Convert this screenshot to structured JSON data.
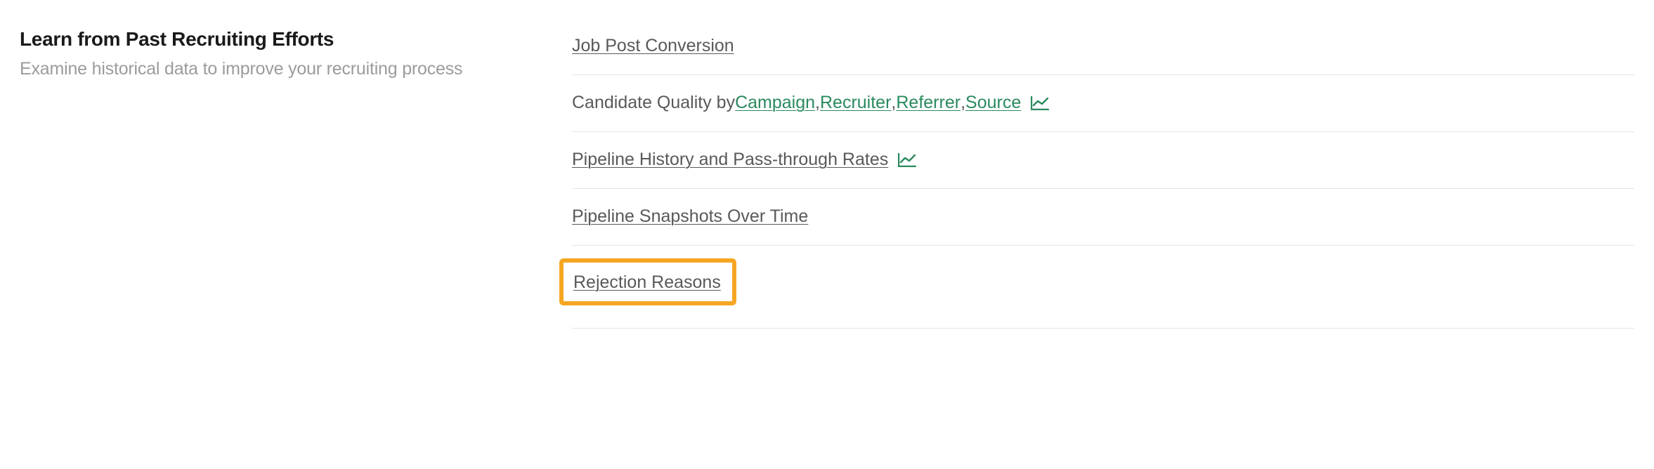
{
  "section": {
    "title": "Learn from Past Recruiting Efforts",
    "subtitle": "Examine historical data to improve your recruiting process"
  },
  "reports": {
    "job_post_conversion": "Job Post Conversion",
    "candidate_quality_prefix": "Candidate Quality by ",
    "candidate_quality_links": {
      "campaign": "Campaign",
      "recruiter": "Recruiter",
      "referrer": "Referrer",
      "source": "Source"
    },
    "pipeline_history": "Pipeline History and Pass-through Rates",
    "pipeline_snapshots": "Pipeline Snapshots Over Time",
    "rejection_reasons": "Rejection Reasons"
  },
  "separator": ", "
}
